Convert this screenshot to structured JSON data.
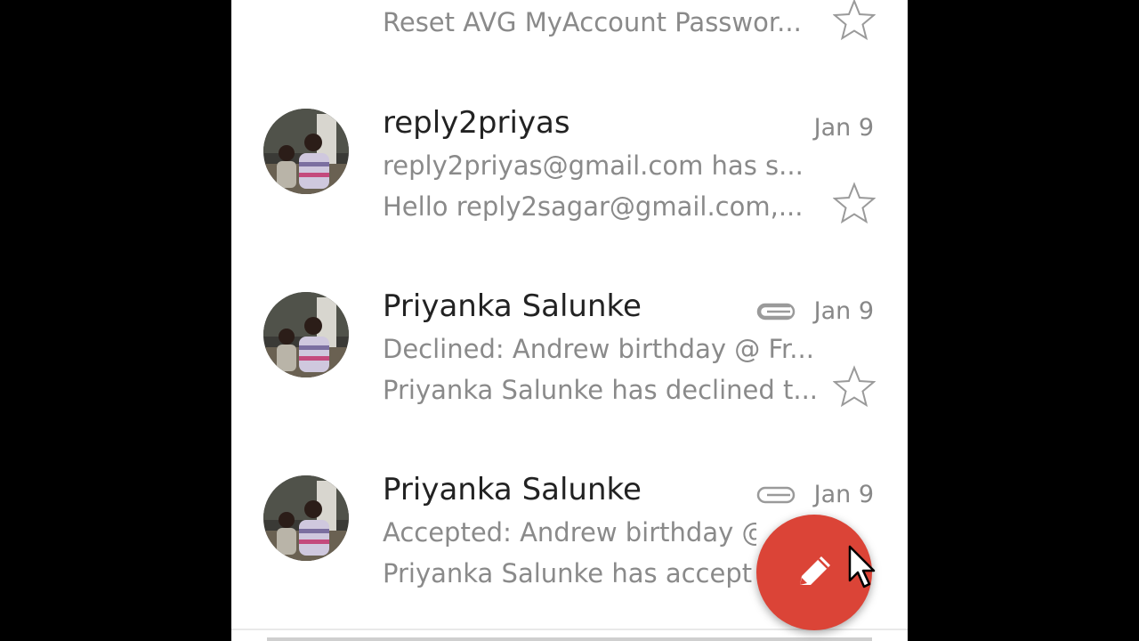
{
  "emails": {
    "partial": {
      "subject": "Reset AVG MyAccount Passwor..."
    },
    "items": [
      {
        "sender": "reply2priyas",
        "subject": "reply2priyas@gmail.com has s...",
        "snippet": "Hello reply2sagar@gmail.com,...",
        "date": "Jan 9",
        "has_attachment": false
      },
      {
        "sender": "Priyanka Salunke",
        "subject": "Declined: Andrew birthday @ Fr...",
        "snippet": "Priyanka Salunke has declined t...",
        "date": "Jan 9",
        "has_attachment": true
      },
      {
        "sender": "Priyanka Salunke",
        "subject": "Accepted: Andrew birthday @",
        "snippet": "Priyanka Salunke has accept",
        "date": "Jan 9",
        "has_attachment": true
      }
    ]
  },
  "compose": {
    "icon": "pencil-icon",
    "color": "#db4437"
  }
}
